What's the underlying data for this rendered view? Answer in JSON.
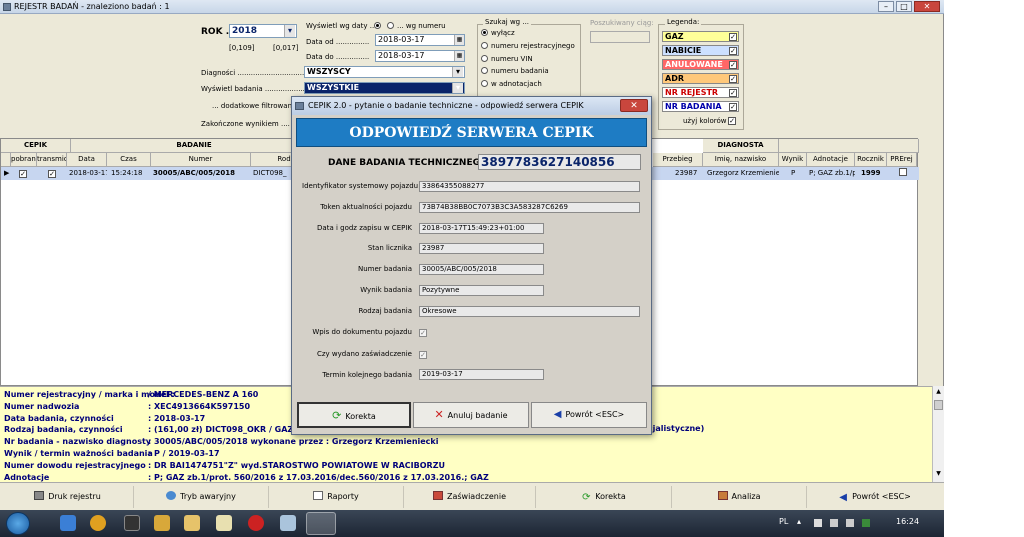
{
  "window": {
    "title": "REJESTR BADAŃ - znaleziono badań : 1"
  },
  "filters": {
    "rok_label": "ROK ...",
    "rok_value": "2018",
    "range_left": "[0,109]",
    "range_right": "[0,017]",
    "show_by_label": "Wyświetl wg daty ...",
    "by_number_label": "... wg numeru",
    "date_from_label": "Data od ...............",
    "date_from": "2018-03-17",
    "date_to_label": "Data do ...............",
    "date_to": "2018-03-17",
    "diagnosci_label": "Diagności ..................................",
    "diagnosci_value": "WSZYSCY",
    "wyswietl_label": "Wyświetl badania ..........................",
    "wyswietl_value": "WSZYSTKIE",
    "dodatkowe_label": "... dodatkowe filtrowanie",
    "zakonczone_label": "Zakończone wynikiem ....",
    "search_group_label": "Szukaj wg ...",
    "search_options": [
      "wyłącz",
      "numeru rejestracyjnego",
      "numeru VIN",
      "numeru badania",
      "w adnotacjach"
    ],
    "search_field_label": "Poszukiwany ciąg:",
    "legend_label": "Legenda:",
    "legend_items": [
      {
        "label": "GAZ",
        "bg": "#ffff99",
        "color": "#000000"
      },
      {
        "label": "NABICIE",
        "bg": "#cce0ff",
        "color": "#000000"
      },
      {
        "label": "ANULOWANE",
        "bg": "#ff6666",
        "color": "#ffffff"
      },
      {
        "label": "ADR",
        "bg": "#ffc87a",
        "color": "#000000"
      },
      {
        "label": "NR REJESTR",
        "bg": "#ffffff",
        "color": "#cc0000"
      },
      {
        "label": "NR BADANIA",
        "bg": "#ffffff",
        "color": "#0000aa"
      }
    ],
    "use_colors_label": "użyj kolorów"
  },
  "grid": {
    "groups": [
      "CEPIK",
      "BADANIE",
      "DIAGNOSTA"
    ],
    "columns": [
      "pobrani",
      "transmic",
      "Data",
      "Czas",
      "Numer",
      "Rod",
      "Przebieg",
      "Imię, nazwisko",
      "Wynik",
      "Adnotacje",
      "Rocznik",
      "PRErej"
    ],
    "row": {
      "date": "2018-03-17",
      "time": "15:24:18",
      "number": "30005/ABC/005/2018",
      "rod": "DICT098_",
      "przebieg": "23987",
      "diagnosta": "Grzegorz Krzemieniecl",
      "wynik": "P",
      "adnotacje": "P; GAZ zb.1/p",
      "rocznik": "1999"
    }
  },
  "info": {
    "rows": [
      {
        "label": "Numer rejestracyjny / marka i model :",
        "value": "/ MERCEDES-BENZ A 160"
      },
      {
        "label": "Numer nadwozia",
        "value": ": XEC4913664K597150"
      },
      {
        "label": "Data badania, czynności",
        "value": ": 2018-03-17"
      },
      {
        "label": "Rodzaj badania, czynności",
        "value": ": (161,00 zł) DICT098_OKR / GAZ /"
      },
      {
        "label": "Nr badania - nazwisko diagnosty",
        "value": ": 30005/ABC/005/2018 wykonane przez : Grzegorz Krzemieniecki"
      },
      {
        "label": "Wynik / termin ważności badania",
        "value": ": P / 2019-03-17"
      },
      {
        "label": "Numer dowodu rejestracyjnego",
        "value": ": DR BAI1474751\"Z\" wyd.STAROSTWO POWIATOWE W RACIBORZU"
      },
      {
        "label": "Adnotacje",
        "value": ": P; GAZ zb.1/prot. 560/2016 z 17.03.2016/dec.560/2016 z 17.03.2016.; GAZ"
      }
    ],
    "extra_text": "specjalistyczne)"
  },
  "toolbar": {
    "buttons": [
      "Druk rejestru",
      "Tryb awaryjny",
      "Raporty",
      "Zaświadczenie",
      "Korekta",
      "Analiza",
      "Powrót <ESC>"
    ]
  },
  "taskbar": {
    "lang": "PL",
    "time": "16:24"
  },
  "dialog": {
    "title": "CEPIK 2.0 - pytanie o badanie techniczne - odpowiedź serwera CEPIK",
    "banner": "ODPOWIEDŹ SERWERA CEPIK",
    "id_label": "DANE BADANIA TECHNICZNEGO ID:",
    "id_value": "3897783627140856",
    "fields": [
      {
        "label": "Identyfikator systemowy pojazdu",
        "value": "33864355088277"
      },
      {
        "label": "Token aktualności pojazdu",
        "value": "73B74B38BB0C7073B3C3A583287C6269"
      },
      {
        "label": "Data i godz zapisu w CEPIK",
        "value": "2018-03-17T15:49:23+01:00"
      },
      {
        "label": "Stan licznika",
        "value": "23987"
      },
      {
        "label": "Numer badania",
        "value": "30005/ABC/005/2018"
      },
      {
        "label": "Wynik badania",
        "value": "Pozytywne"
      },
      {
        "label": "Rodzaj badania",
        "value": "Okresowe"
      }
    ],
    "check1_label": "Wpis do dokumentu pojazdu",
    "check2_label": "Czy wydano zaświadczenie",
    "next_label": "Termin kolejnego badania",
    "next_value": "2019-03-17",
    "buttons": {
      "korekta": "Korekta",
      "anuluj": "Anuluj badanie",
      "powrot": "Powrót <ESC>"
    }
  }
}
